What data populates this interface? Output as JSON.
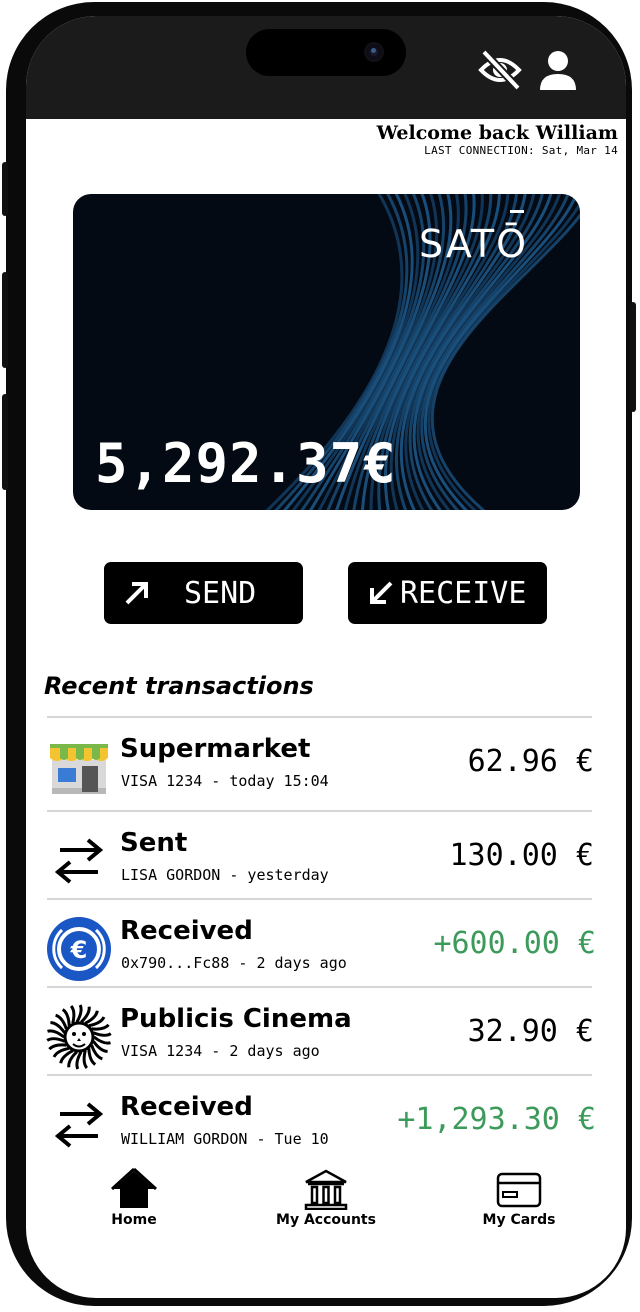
{
  "header": {
    "welcome": "Welcome back William",
    "last_connection": "LAST CONNECTION: Sat, Mar 14",
    "icons": [
      "eye-off-icon",
      "user-icon"
    ]
  },
  "card": {
    "brand": "SATŌ",
    "balance": "5,292.37€"
  },
  "actions": {
    "send_label": "SEND",
    "receive_label": "RECEIVE"
  },
  "transactions": {
    "title": "Recent transactions",
    "items": [
      {
        "title": "Supermarket",
        "subtitle": "VISA 1234 - today 15:04",
        "amount": "62.96 €",
        "icon": "store-icon",
        "positive": false
      },
      {
        "title": "Sent",
        "subtitle": "LISA GORDON - yesterday",
        "amount": "130.00 €",
        "icon": "transfer-icon",
        "positive": false
      },
      {
        "title": "Received",
        "subtitle": "0x790...Fc88 - 2 days ago",
        "amount": "+600.00 €",
        "icon": "euro-coin-icon",
        "positive": true
      },
      {
        "title": "Publicis Cinema",
        "subtitle": "VISA 1234 - 2 days ago",
        "amount": "32.90 €",
        "icon": "lion-logo-icon",
        "positive": false
      },
      {
        "title": "Received",
        "subtitle": "WILLIAM GORDON - Tue 10",
        "amount": "+1,293.30 €",
        "icon": "transfer-icon",
        "positive": true
      }
    ]
  },
  "nav": {
    "items": [
      {
        "label": "Home",
        "icon": "home-icon"
      },
      {
        "label": "My Accounts",
        "icon": "bank-icon"
      },
      {
        "label": "My Cards",
        "icon": "card-icon"
      }
    ]
  },
  "colors": {
    "positive": "#3c9a5a",
    "card_bg": "#040a14",
    "card_lines": "#1e5a8c"
  }
}
